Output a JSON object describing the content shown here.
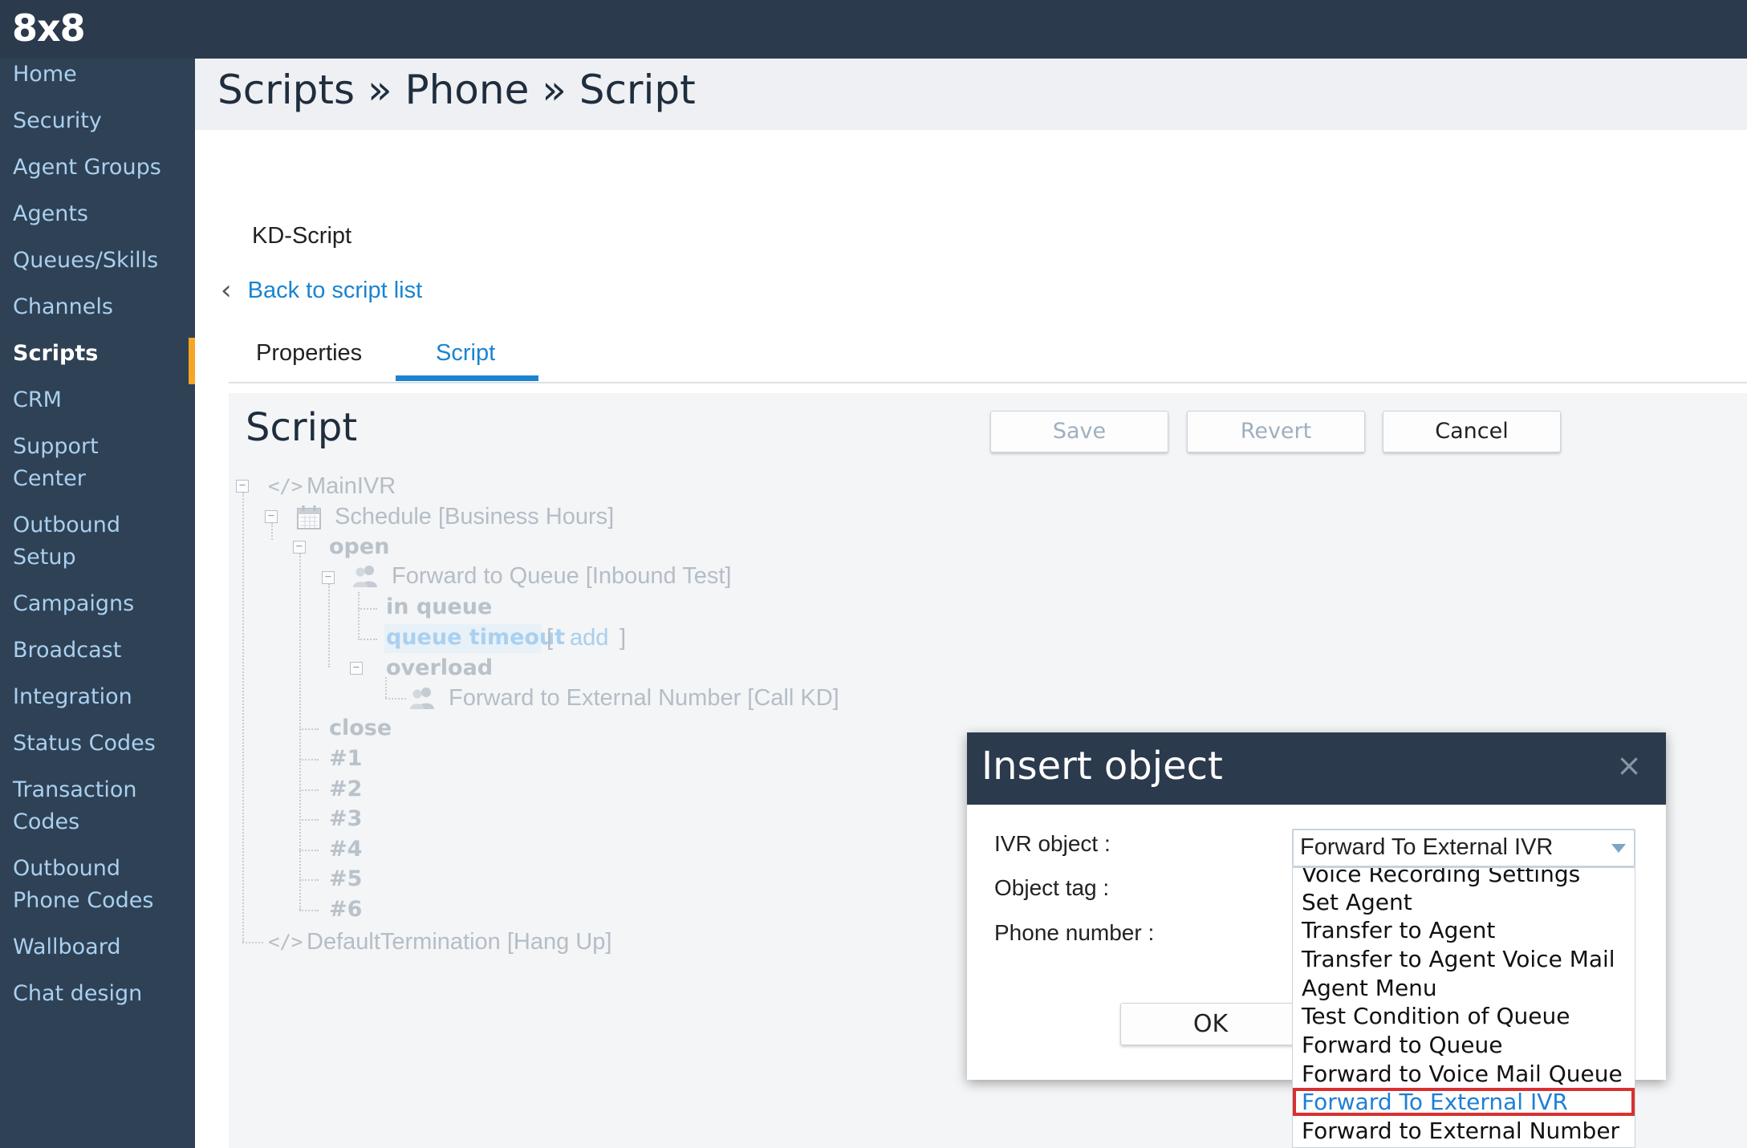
{
  "app": {
    "logo": "8x8"
  },
  "sidebar": {
    "items": [
      {
        "label": "Home"
      },
      {
        "label": "Security"
      },
      {
        "label": "Agent Groups"
      },
      {
        "label": "Agents"
      },
      {
        "label": "Queues/Skills"
      },
      {
        "label": "Channels"
      },
      {
        "label": "Scripts",
        "active": true
      },
      {
        "label": "CRM"
      },
      {
        "label": "Support\nCenter"
      },
      {
        "label": "Outbound\nSetup"
      },
      {
        "label": "Campaigns"
      },
      {
        "label": "Broadcast"
      },
      {
        "label": "Integration"
      },
      {
        "label": "Status Codes"
      },
      {
        "label": "Transaction\nCodes"
      },
      {
        "label": "Outbound\nPhone Codes"
      },
      {
        "label": "Wallboard"
      },
      {
        "label": "Chat design"
      }
    ],
    "active_accent": "#f5a623"
  },
  "header": {
    "breadcrumb": "Scripts » Phone » Script"
  },
  "content": {
    "script_name": "KD-Script",
    "back_link": "Back to script list",
    "tabs": [
      {
        "label": "Properties"
      },
      {
        "label": "Script",
        "active": true
      }
    ]
  },
  "editor": {
    "title": "Script",
    "buttons": {
      "save": "Save",
      "revert": "Revert",
      "cancel": "Cancel"
    },
    "tree": {
      "main_ivr": "MainIVR",
      "schedule": "Schedule [Business Hours]",
      "open": "open",
      "forward_queue": "Forward to Queue [Inbound Test]",
      "in_queue": "in queue",
      "queue_timeout": "queue timeout",
      "add_open": "[",
      "add": "add",
      "add_close": "]",
      "overload": "overload",
      "forward_external": "Forward to External Number [Call KD]",
      "close": "close",
      "keys": [
        "#1",
        "#2",
        "#3",
        "#4",
        "#5",
        "#6"
      ],
      "default_termination": "DefaultTermination [Hang Up]"
    }
  },
  "modal": {
    "title": "Insert object",
    "close_icon": "×",
    "fields": {
      "ivr_object": "IVR object :",
      "object_tag": "Object tag :",
      "phone_number": "Phone number :"
    },
    "ok": "OK",
    "select": {
      "value": "Forward To External IVR",
      "options": [
        "Voice Recording Settings",
        "Set Agent",
        "Transfer to Agent",
        "Transfer to Agent Voice Mail",
        "Agent Menu",
        "Test Condition of Queue",
        "Forward to Queue",
        "Forward to Voice Mail Queue",
        "Forward To External IVR",
        "Forward to External Number"
      ],
      "highlighted_index": 8,
      "highlight_color": "#d83030"
    }
  },
  "colors": {
    "topbar": "#2b3a4d",
    "sidebar": "#2f4154",
    "link": "#1a84d0"
  }
}
